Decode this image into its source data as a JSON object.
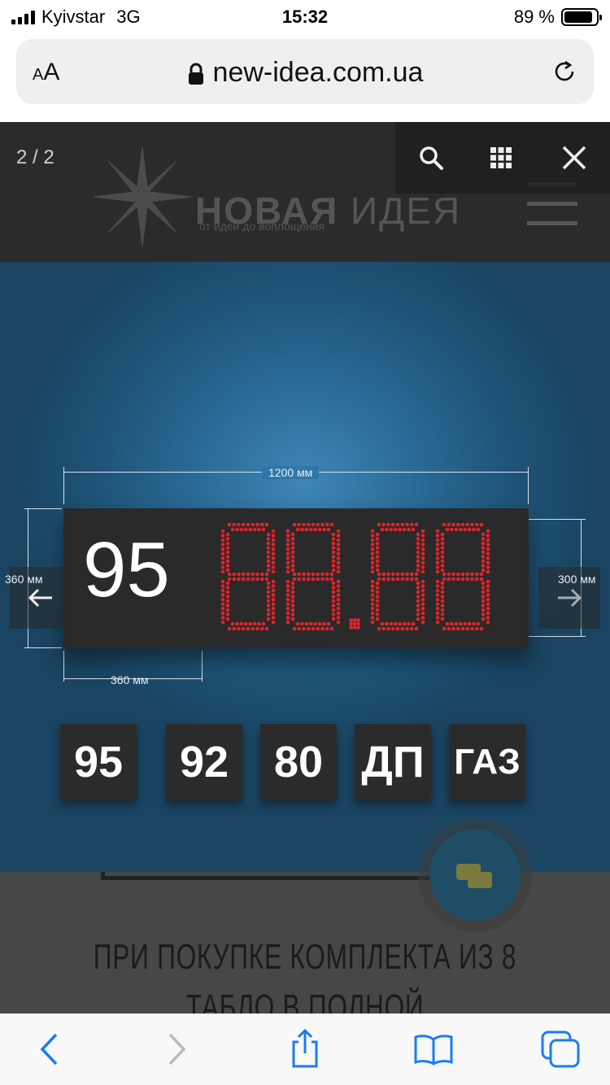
{
  "status_bar": {
    "carrier": "Kyivstar",
    "network": "3G",
    "time": "15:32",
    "battery": "89 %",
    "battery_level": 0.89
  },
  "browser": {
    "text_size_label": "AA",
    "url": "new-idea.com.ua"
  },
  "site": {
    "logo_word1": "НОВАЯ",
    "logo_word2": "ИДЕЯ",
    "slogan": "от идеи до воплощения"
  },
  "lightbox": {
    "counter": "2 / 2",
    "sign": {
      "fuel_label": "95",
      "led_digits": "88.88",
      "dim_width": "1200 мм",
      "dim_height_left": "360 мм",
      "dim_height_right": "300 мм",
      "dim_label_width": "360 мм"
    },
    "tiles": [
      "95",
      "92",
      "80",
      "ДП",
      "ГАЗ"
    ]
  },
  "page": {
    "promo_line1": "ПРИ ПОКУПКЕ КОМПЛЕКТА ИЗ 8",
    "promo_line2": "ТАБЛО В ПОЛНОЙ КОМПЛЕКТАЦИИ"
  },
  "icons": {
    "search": "search-icon",
    "grid": "grid-icon",
    "close": "close-icon",
    "prev": "arrow-left-icon",
    "next": "arrow-right-icon"
  },
  "colors": {
    "led": "#e0242a",
    "accent_ios": "#1a7cf5"
  }
}
